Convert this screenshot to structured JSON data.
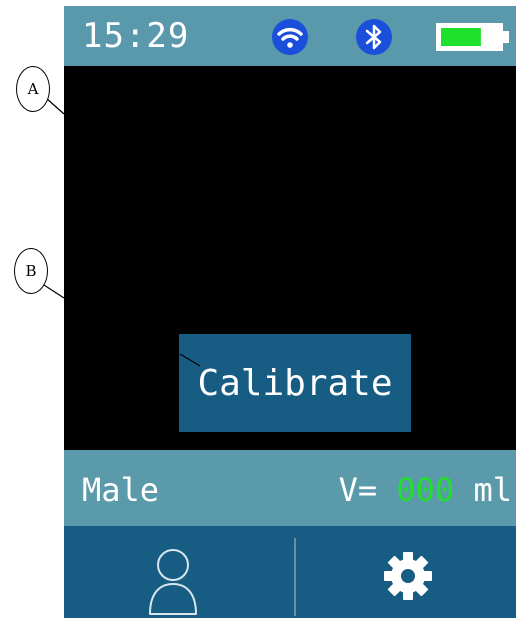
{
  "status_bar": {
    "time": "15:29",
    "icons": [
      "wifi-icon",
      "bluetooth-icon",
      "battery-icon"
    ],
    "battery_level": 0.7,
    "color": "#5a99ab"
  },
  "main": {
    "calibrate_label": "Calibrate"
  },
  "info_bar": {
    "sex": "Male",
    "volume_prefix": "V=",
    "volume_value": "000",
    "volume_unit": "ml",
    "volume_color": "#21e02c"
  },
  "nav_bar": {
    "icons": [
      "user-icon",
      "gear-icon"
    ],
    "color": "#175c83"
  },
  "annotations": {
    "callout_a": "A",
    "callout_b": "B"
  }
}
